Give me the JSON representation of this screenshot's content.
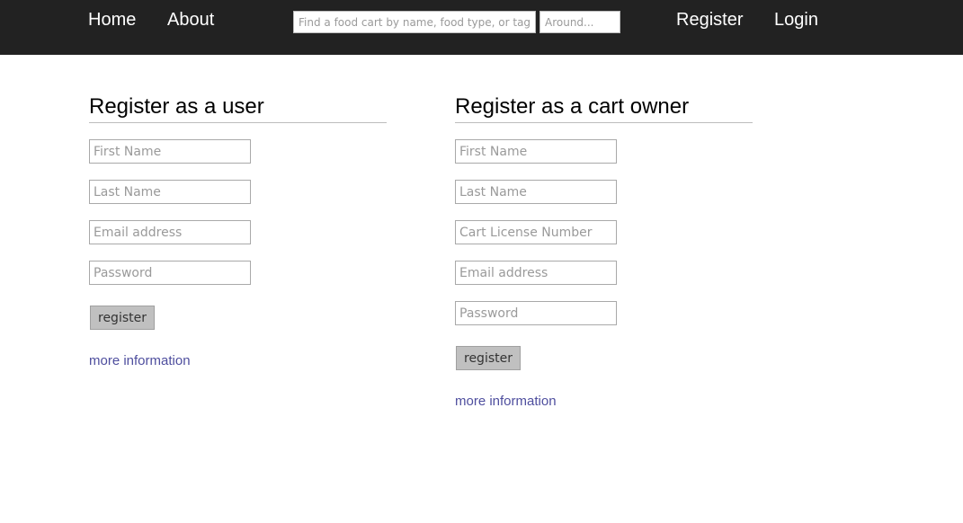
{
  "nav": {
    "home": "Home",
    "about": "About",
    "register": "Register",
    "login": "Login",
    "search_placeholder": "Find a food cart by name, food type, or tags",
    "near_placeholder": "Around..."
  },
  "user_form": {
    "title": "Register as a user",
    "first_name_placeholder": "First Name",
    "last_name_placeholder": "Last Name",
    "email_placeholder": "Email address",
    "password_placeholder": "Password",
    "submit_label": "register",
    "more_info": "more information"
  },
  "owner_form": {
    "title": "Register as a cart owner",
    "first_name_placeholder": "First Name",
    "last_name_placeholder": "Last Name",
    "license_placeholder": "Cart License Number",
    "email_placeholder": "Email address",
    "password_placeholder": "Password",
    "submit_label": "register",
    "more_info": "more information"
  },
  "colors": {
    "header_bg": "#222222",
    "link": "#4e4e9e",
    "button_bg": "#c0c0c0"
  }
}
